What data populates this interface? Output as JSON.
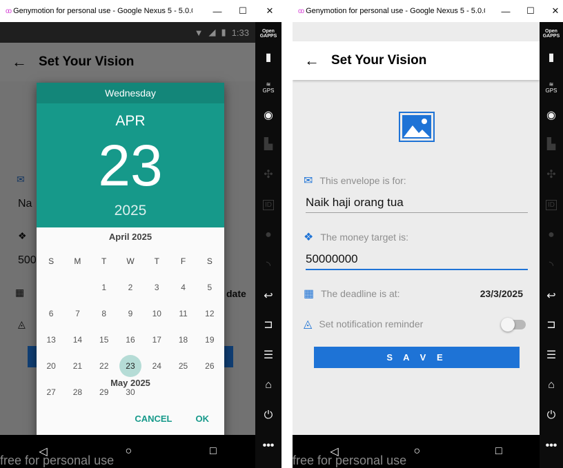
{
  "window": {
    "title": "Genymotion for personal use - Google Nexus 5 - 5.0.0...",
    "controls": {
      "minimize": "—",
      "maximize": "☐",
      "close": "✕"
    }
  },
  "statusbar": {
    "time": "1:33"
  },
  "app": {
    "title": "Set Your Vision",
    "back_icon": "arrow-left-icon"
  },
  "form": {
    "envelope_label": "This envelope is for:",
    "envelope_value": "Naik haji orang tua",
    "money_label": "The money target is:",
    "money_value": "50000000",
    "deadline_label": "The deadline is at:",
    "deadline_value": "23/3/2025",
    "notification_label": "Set notification reminder",
    "notification_on": false,
    "save_label": "S A V E"
  },
  "underlay": {
    "envelope_partial": "Na",
    "money_partial": "500",
    "deadline_partial": "date"
  },
  "datepicker": {
    "weekday": "Wednesday",
    "month": "APR",
    "day": "23",
    "year": "2025",
    "month_title": "April 2025",
    "next_month_title": "May 2025",
    "weekday_headers": [
      "S",
      "M",
      "T",
      "W",
      "T",
      "F",
      "S"
    ],
    "weeks": [
      [
        "",
        "",
        "1",
        "2",
        "3",
        "4",
        "5"
      ],
      [
        "6",
        "7",
        "8",
        "9",
        "10",
        "11",
        "12"
      ],
      [
        "13",
        "14",
        "15",
        "16",
        "17",
        "18",
        "19"
      ],
      [
        "20",
        "21",
        "22",
        "23",
        "24",
        "25",
        "26"
      ],
      [
        "27",
        "28",
        "29",
        "30",
        "",
        "",
        ""
      ]
    ],
    "selected": "23",
    "cancel_label": "CANCEL",
    "ok_label": "OK"
  },
  "side_toolbar": {
    "open_gapps": "Open GAPPS",
    "gps": "GPS",
    "id": "ID",
    "icons": [
      "open-gapps-icon",
      "battery-icon",
      "gps-icon",
      "camera-icon",
      "capture-icon",
      "dpad-icon",
      "id-icon",
      "media-icon",
      "cast-icon",
      "back-icon",
      "recent-apps-icon",
      "menu-icon",
      "home-icon",
      "power-icon",
      "more-icon"
    ]
  },
  "watermark": "free for personal use"
}
